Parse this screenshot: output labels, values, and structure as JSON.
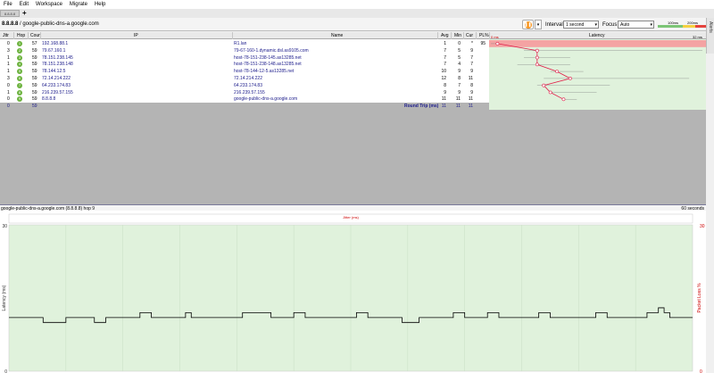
{
  "menu": [
    "File",
    "Edit",
    "Workspace",
    "Migrate",
    "Help"
  ],
  "tab": {
    "label": "8.8.8.8",
    "add": "+"
  },
  "target": {
    "host": "8.8.8.8",
    "sep": " / ",
    "name": "google-public-dns-a.google.com"
  },
  "toolbar": {
    "interval_label": "Interval",
    "interval_value": "1 second",
    "focus_label": "Focus",
    "focus_value": "Auto",
    "scale_100": "100ms",
    "scale_200": "200ms",
    "caret": "▾"
  },
  "alerts": "Alerts",
  "columns": {
    "jttr": "Jttr",
    "hop": "Hop",
    "count": "Coun",
    "ip": "IP",
    "name": "Name",
    "avg": "Avg",
    "min": "Min",
    "cur": "Cur",
    "pl": "PL%",
    "latency": "Latency",
    "lat_min": "0 ms",
    "lat_max": "32 ms"
  },
  "hops": [
    {
      "jttr": "0",
      "hop": "1",
      "count": "57",
      "ip": "192.168.88.1",
      "name": "R1.lan",
      "avg": "1",
      "min": "0",
      "cur": "*",
      "pl": "95"
    },
    {
      "jttr": "3",
      "hop": "2",
      "count": "59",
      "ip": "79.67.160.1",
      "name": "79-67-160-1.dynamic.dsl.as9105.com",
      "avg": "7",
      "min": "5",
      "cur": "9",
      "pl": ""
    },
    {
      "jttr": "1",
      "hop": "3",
      "count": "59",
      "ip": "78.151.238.145",
      "name": "host-78-151-238-145.as13285.net",
      "avg": "7",
      "min": "5",
      "cur": "7",
      "pl": ""
    },
    {
      "jttr": "1",
      "hop": "4",
      "count": "59",
      "ip": "78.151.238.148",
      "name": "host-78-151-238-148.as13285.net",
      "avg": "7",
      "min": "4",
      "cur": "7",
      "pl": ""
    },
    {
      "jttr": "1",
      "hop": "5",
      "count": "59",
      "ip": "78.144.12.5",
      "name": "host-78-144-12-5.as13285.net",
      "avg": "10",
      "min": "9",
      "cur": "9",
      "pl": ""
    },
    {
      "jttr": "3",
      "hop": "6",
      "count": "59",
      "ip": "72.14.214.222",
      "name": "72.14.214.222",
      "avg": "12",
      "min": "8",
      "cur": "11",
      "pl": ""
    },
    {
      "jttr": "0",
      "hop": "7",
      "count": "59",
      "ip": "64.233.174.83",
      "name": "64.233.174.83",
      "avg": "8",
      "min": "7",
      "cur": "8",
      "pl": ""
    },
    {
      "jttr": "1",
      "hop": "8",
      "count": "59",
      "ip": "216.239.57.155",
      "name": "216.239.57.155",
      "avg": "9",
      "min": "9",
      "cur": "9",
      "pl": ""
    },
    {
      "jttr": "0",
      "hop": "9",
      "count": "59",
      "ip": "8.8.8.8",
      "name": "google-public-dns-a.google.com",
      "avg": "11",
      "min": "11",
      "cur": "11",
      "pl": ""
    }
  ],
  "total": {
    "jttr": "0",
    "count": "59",
    "label": "Round Trip (ms)",
    "avg": "11",
    "min": "11",
    "cur": "11"
  },
  "latency_points": [
    {
      "avg": 1,
      "min": 0,
      "max": 1
    },
    {
      "avg": 7,
      "min": 5,
      "max": 32
    },
    {
      "avg": 7,
      "min": 5,
      "max": 12
    },
    {
      "avg": 7,
      "min": 4,
      "max": 12
    },
    {
      "avg": 10,
      "min": 9,
      "max": 14
    },
    {
      "avg": 12,
      "min": 8,
      "max": 30
    },
    {
      "avg": 8,
      "min": 7,
      "max": 18
    },
    {
      "avg": 9,
      "min": 9,
      "max": 16
    },
    {
      "avg": 11,
      "min": 11,
      "max": 13
    }
  ],
  "bottom": {
    "title": "google-public-dns-a.google.com (8.8.8.8) hop 9",
    "span": "60 seconds",
    "jitter_label": "Jitter (ms)",
    "ylabel": "Latency (ms)",
    "y2label": "Packet Loss %",
    "ymax": "30",
    "y2max": "30",
    "ymin": "0",
    "y2min": "0"
  },
  "chart_data": {
    "type": "line",
    "ylabel": "Latency (ms)",
    "y2label": "Packet Loss %",
    "ylim": [
      0,
      30
    ],
    "values": [
      11,
      11,
      11,
      11,
      11,
      11,
      10,
      10,
      10,
      10,
      11,
      11,
      11,
      11,
      11,
      10,
      10,
      11,
      11,
      11,
      11,
      11,
      11,
      12,
      12,
      11,
      11,
      11,
      11,
      11,
      11,
      12,
      11,
      11,
      11,
      11,
      11,
      11,
      11,
      11,
      11,
      12,
      12,
      12,
      12,
      12,
      11,
      11,
      11,
      11,
      12,
      12,
      11,
      11,
      11,
      11,
      11,
      11,
      11,
      11,
      11,
      12,
      12,
      11,
      11,
      11,
      11,
      11,
      11,
      10,
      10,
      10,
      11,
      11,
      11,
      11,
      11,
      11,
      12,
      12,
      11,
      11,
      11,
      11,
      12,
      12,
      11,
      11,
      11,
      11,
      11,
      11,
      11,
      12,
      12,
      11,
      11,
      11,
      11,
      11,
      11,
      11,
      11,
      12,
      12,
      11,
      11,
      11,
      11,
      11,
      11,
      11,
      12,
      12,
      13,
      12,
      11,
      11,
      11,
      11
    ]
  }
}
